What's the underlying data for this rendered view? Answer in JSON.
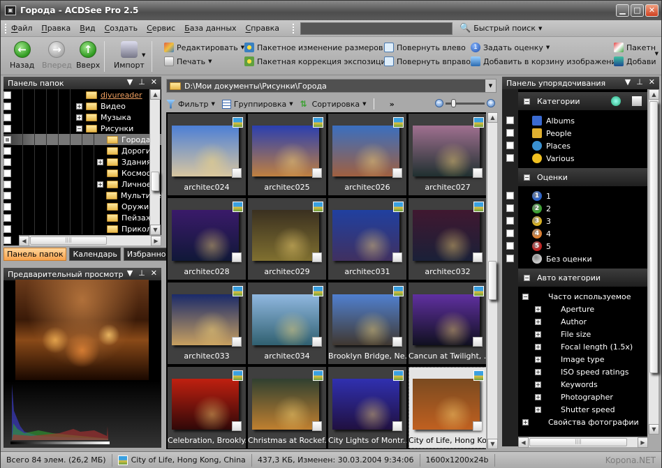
{
  "window": {
    "title": "Города - ACDSee Pro 2.5",
    "minimize_glyph": "▁",
    "maximize_glyph": "□",
    "close_glyph": "✕"
  },
  "menu": {
    "items": [
      "Файл",
      "Правка",
      "Вид",
      "Создать",
      "Сервис",
      "База данных",
      "Справка"
    ],
    "search_value": "",
    "quick_search_label": "Быстрый поиск"
  },
  "toolbar": {
    "back": "Назад",
    "forward": "Вперед",
    "up": "Вверх",
    "import": "Импорт",
    "edit": "Редактировать",
    "print": "Печать",
    "batch_resize": "Пакетное изменение размеров",
    "batch_exposure": "Пакетная коррекция экспозиции",
    "rotate_left": "Повернуть влево",
    "rotate_right": "Повернуть вправо",
    "set_rating": "Задать оценку",
    "add_basket": "Добавить в корзину изображений",
    "batch_more": "Пакетн",
    "add_more": "Добави"
  },
  "folders_panel": {
    "title": "Панель папок",
    "items": [
      {
        "name": "djvureader",
        "level": 2,
        "expander": "",
        "link": true
      },
      {
        "name": "Видео",
        "level": 2,
        "expander": "+"
      },
      {
        "name": "Музыка",
        "level": 2,
        "expander": "+"
      },
      {
        "name": "Рисунки",
        "level": 2,
        "expander": "−"
      },
      {
        "name": "Города",
        "level": 3,
        "expander": "",
        "selected": true
      },
      {
        "name": "Дороги",
        "level": 3,
        "expander": ""
      },
      {
        "name": "Здания",
        "level": 3,
        "expander": "+"
      },
      {
        "name": "Космос",
        "level": 3,
        "expander": ""
      },
      {
        "name": "Личное",
        "level": 3,
        "expander": "+"
      },
      {
        "name": "Мультиме",
        "level": 3,
        "expander": ""
      },
      {
        "name": "Оружие",
        "level": 3,
        "expander": ""
      },
      {
        "name": "Пейзажи",
        "level": 3,
        "expander": ""
      },
      {
        "name": "Приколы",
        "level": 3,
        "expander": ""
      }
    ],
    "tabs": [
      "Панель папок",
      "Календарь",
      "Избранное"
    ],
    "active_tab": 0
  },
  "preview_panel": {
    "title": "Предварительный просмотр"
  },
  "content": {
    "path": "D:\\Мои документы\\Рисунки\\Города",
    "filter": "Фильтр",
    "grouping": "Группировка",
    "sorting": "Сортировка",
    "more": "»",
    "zoom_level": 0.2,
    "thumbnails": [
      {
        "label": "architec024",
        "colors": [
          "#4c7fd6",
          "#d8c6a0"
        ]
      },
      {
        "label": "architec025",
        "colors": [
          "#2a3fb0",
          "#c08040"
        ]
      },
      {
        "label": "architec026",
        "colors": [
          "#3a6fc0",
          "#a06040"
        ]
      },
      {
        "label": "architec027",
        "colors": [
          "#a07090",
          "#203030"
        ]
      },
      {
        "label": "architec028",
        "colors": [
          "#3a1a6a",
          "#101838"
        ]
      },
      {
        "label": "architec029",
        "colors": [
          "#3a3020",
          "#807030"
        ]
      },
      {
        "label": "architec031",
        "colors": [
          "#2040a0",
          "#403060"
        ]
      },
      {
        "label": "architec032",
        "colors": [
          "#401830",
          "#1a2038"
        ]
      },
      {
        "label": "architec033",
        "colors": [
          "#1a2a6a",
          "#c8a060"
        ]
      },
      {
        "label": "architec034",
        "colors": [
          "#90b8e0",
          "#306070"
        ]
      },
      {
        "label": "Brooklyn Bridge, Ne...",
        "colors": [
          "#5080d0",
          "#403830"
        ]
      },
      {
        "label": "Cancun at Twilight, ...",
        "colors": [
          "#6030a0",
          "#101020"
        ]
      },
      {
        "label": "Celebration, Brookly...",
        "colors": [
          "#c02010",
          "#300808"
        ]
      },
      {
        "label": "Christmas at Rockef...",
        "colors": [
          "#304030",
          "#c08030"
        ]
      },
      {
        "label": "City Lights of Montr...",
        "colors": [
          "#3030b0",
          "#201040"
        ]
      },
      {
        "label": "City of Life, Hong Ko...",
        "colors": [
          "#7a4a20",
          "#c06020"
        ],
        "selected": true
      }
    ]
  },
  "organize_panel": {
    "title": "Панель упорядочивания",
    "categories": {
      "title": "Категории",
      "items": [
        "Albums",
        "People",
        "Places",
        "Various"
      ]
    },
    "ratings": {
      "title": "Оценки",
      "items": [
        {
          "label": "1",
          "color": "#2a62c8"
        },
        {
          "label": "2",
          "color": "#3aa030"
        },
        {
          "label": "3",
          "color": "#d8b020"
        },
        {
          "label": "4",
          "color": "#e08030"
        },
        {
          "label": "5",
          "color": "#c02020"
        },
        {
          "label": "Без оценки",
          "color": "#c8c8c8"
        }
      ]
    },
    "auto_categories": {
      "title": "Авто категории",
      "group": "Часто используемое",
      "items": [
        "Aperture",
        "Author",
        "File size",
        "Focal length (1.5x)",
        "Image type",
        "ISO speed ratings",
        "Keywords",
        "Photographer",
        "Shutter speed"
      ],
      "footer": "Свойства фотографии"
    }
  },
  "status": {
    "total": "Всего 84 элем.  (26,2 МБ)",
    "file": "City of Life, Hong Kong, China",
    "info": "437,3 КБ, Изменен: 30.03.2004 9:34:06",
    "dims": "1600x1200x24b",
    "watermark": "Kopona.NET"
  }
}
